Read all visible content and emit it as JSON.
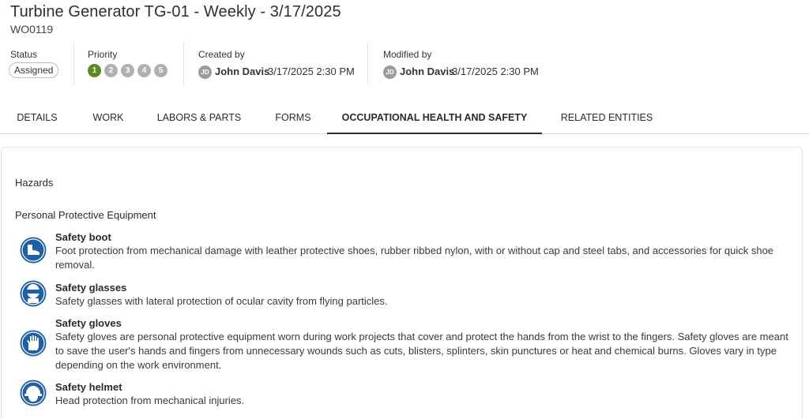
{
  "header": {
    "title": "Turbine Generator TG-01 - Weekly - 3/17/2025",
    "work_order_number": "WO0119"
  },
  "meta": {
    "status_label": "Status",
    "status_value": "Assigned",
    "priority_label": "Priority",
    "priority_levels": [
      "1",
      "2",
      "3",
      "4",
      "5"
    ],
    "priority_selected": "1",
    "created_label": "Created by",
    "created_initials": "JD",
    "created_name": "John Davis",
    "created_date": "3/17/2025 2:30 PM",
    "modified_label": "Modified by",
    "modified_initials": "JD",
    "modified_name": "John Davis",
    "modified_date": "3/17/2025 2:30 PM"
  },
  "tabs": [
    {
      "label": "DETAILS"
    },
    {
      "label": "WORK"
    },
    {
      "label": "LABORS & PARTS"
    },
    {
      "label": "FORMS"
    },
    {
      "label": "OCCUPATIONAL HEALTH AND SAFETY"
    },
    {
      "label": "RELATED ENTITIES"
    }
  ],
  "active_tab": "OCCUPATIONAL HEALTH AND SAFETY",
  "ohs": {
    "hazards_title": "Hazards",
    "ppe_title": "Personal Protective Equipment",
    "ppe_items": [
      {
        "name": "Safety boot",
        "icon": "safety-boot-icon",
        "description": "Foot protection from mechanical damage with leather protective shoes, rubber ribbed nylon, with or without cap and steel tabs, and accessories for quick shoe removal."
      },
      {
        "name": "Safety glasses",
        "icon": "safety-glasses-icon",
        "description": "Safety glasses with lateral protection of ocular cavity from flying particles."
      },
      {
        "name": "Safety gloves",
        "icon": "safety-gloves-icon",
        "description": "Safety gloves are personal protective equipment worn during work projects that cover and protect the hands from the wrist to the fingers. Safety gloves are meant to save the user's hands and fingers from unnecessary wounds such as cuts, blisters, splinters, skin punctures or heat and chemical burns. Gloves vary in type depending on the work environment."
      },
      {
        "name": "Safety helmet",
        "icon": "safety-helmet-icon",
        "description": "Head protection from mechanical injuries."
      }
    ]
  },
  "colors": {
    "ppe_icon_blue": "#1f5fa8",
    "priority_active": "#5b8a1d",
    "priority_inactive": "#b0b0b0"
  }
}
